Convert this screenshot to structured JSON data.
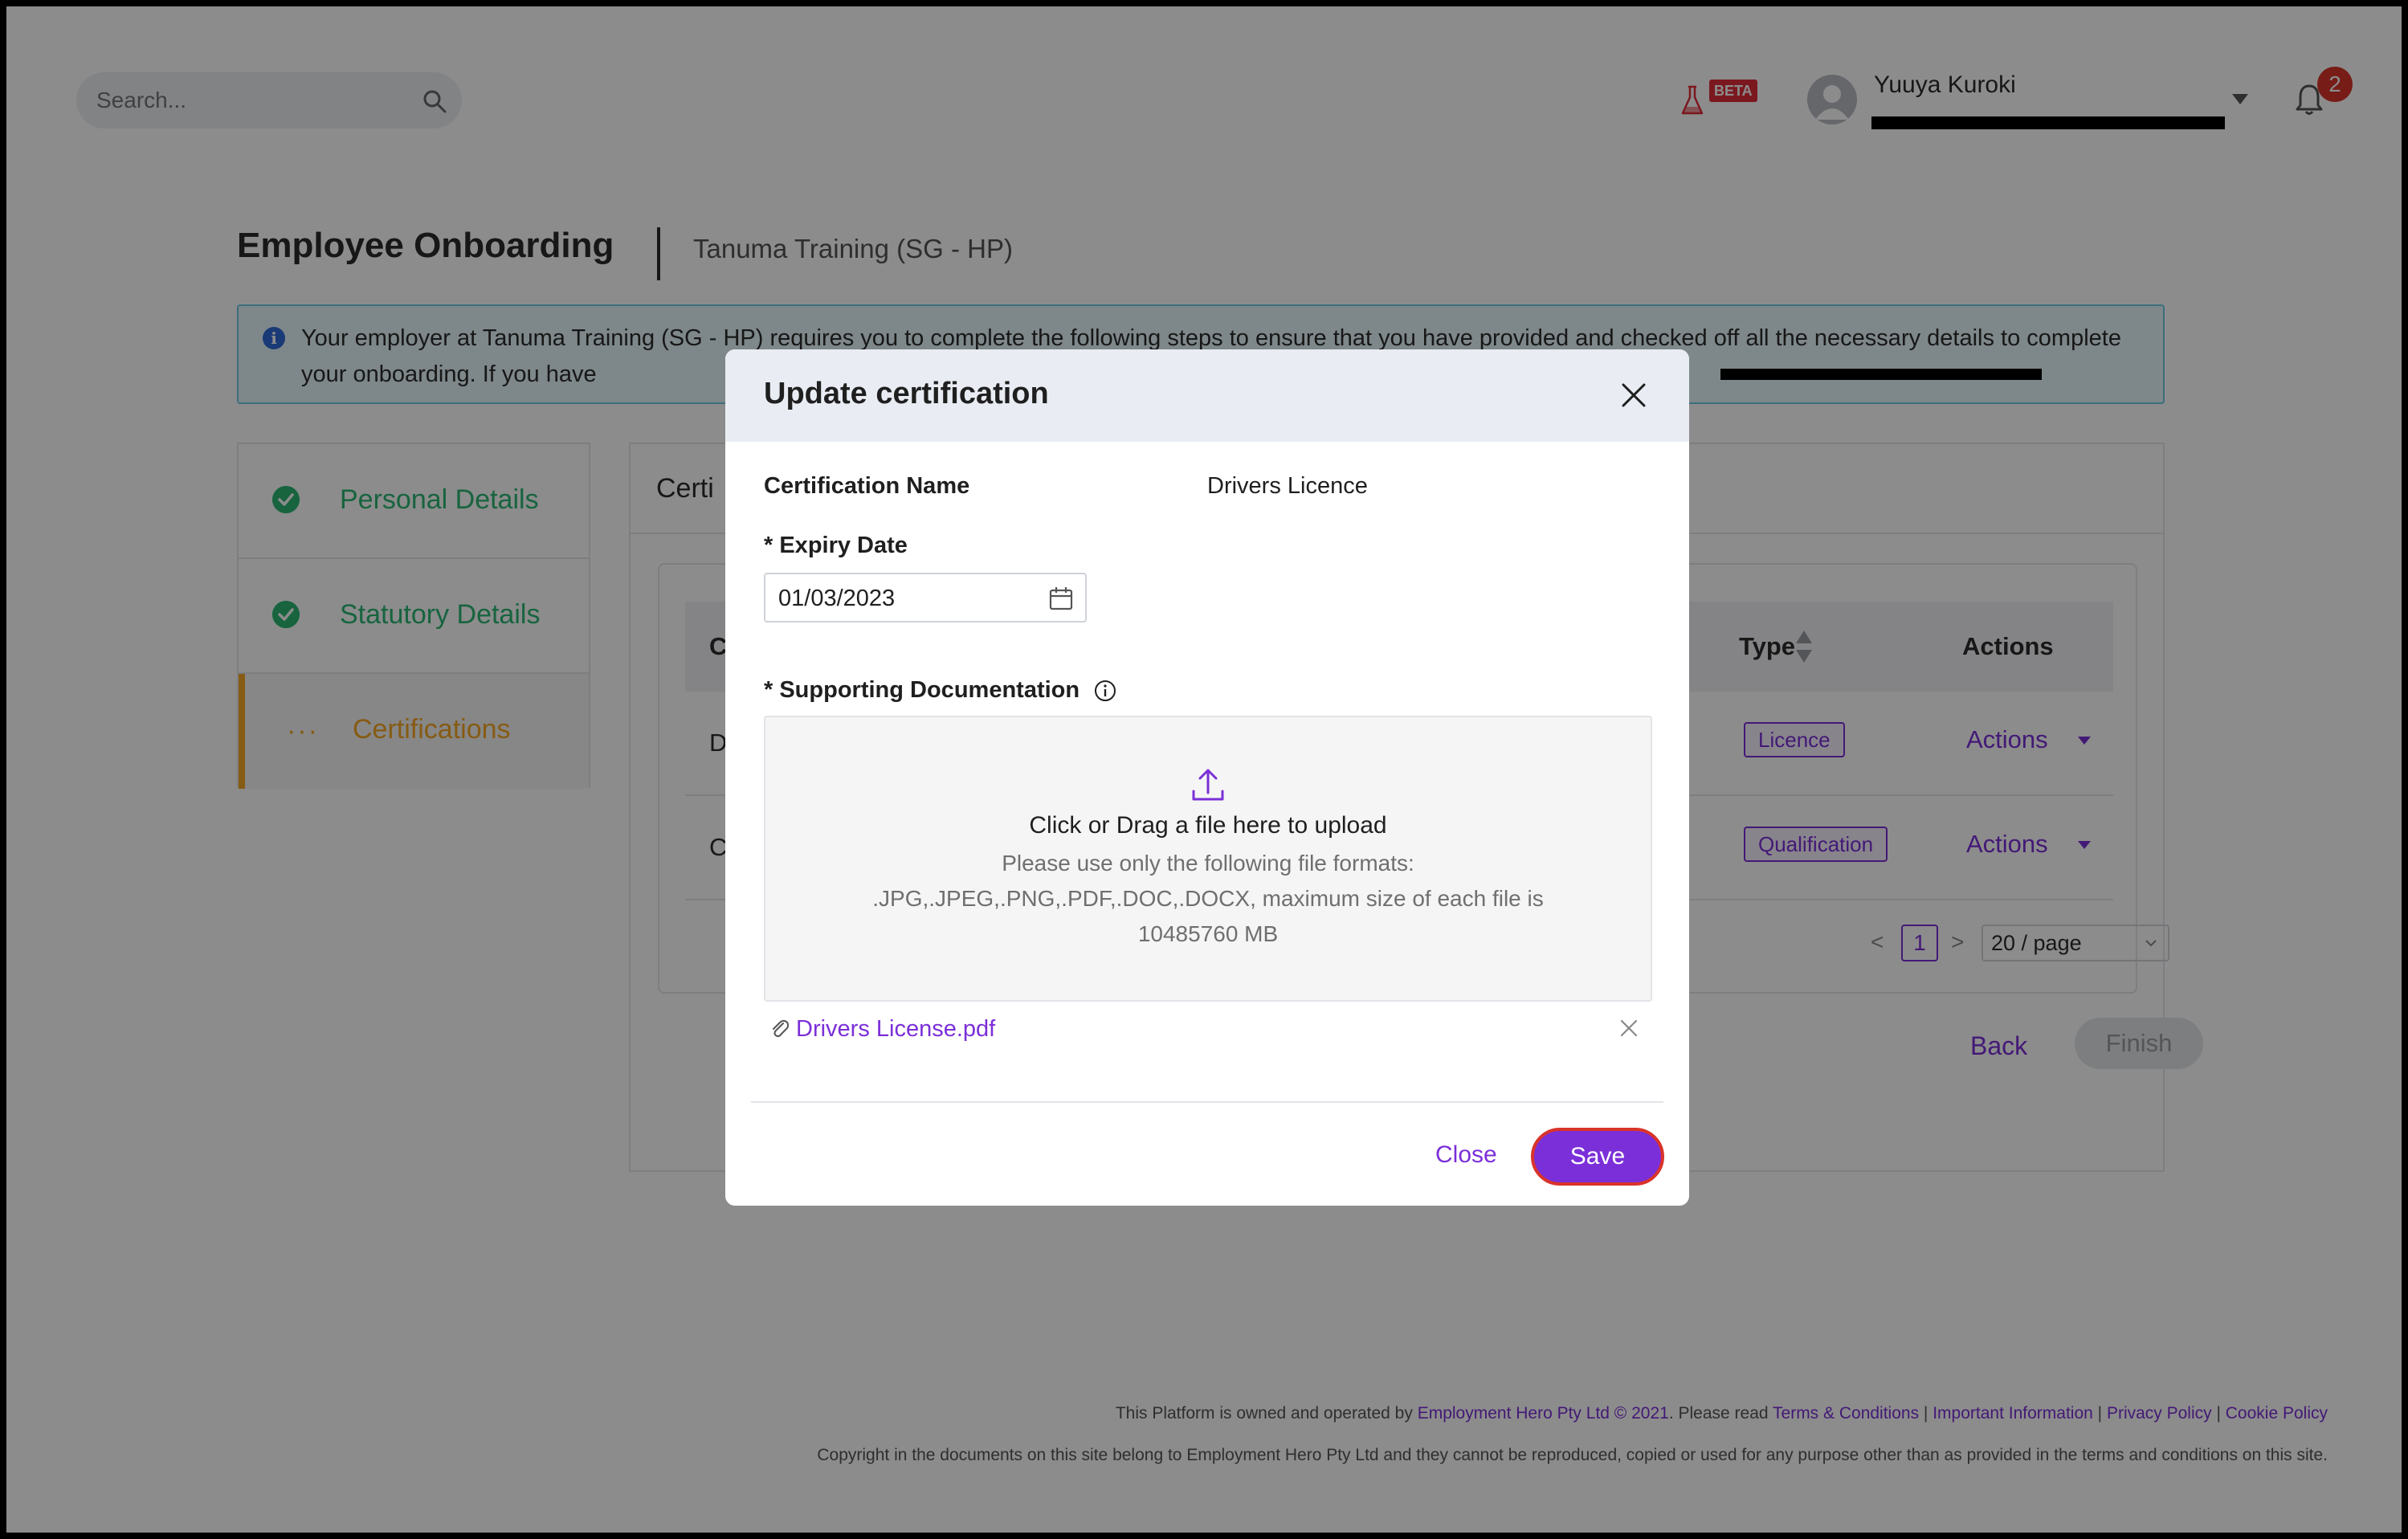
{
  "header": {
    "search_placeholder": "Search...",
    "beta_label": "BETA",
    "user_name": "Yuuya Kuroki",
    "notification_count": "2"
  },
  "page": {
    "title": "Employee Onboarding",
    "org_name": "Tanuma Training (SG - HP)",
    "info_text": "Your employer at Tanuma Training (SG - HP) requires you to complete the following steps to ensure that you have provided and checked off all the necessary details to complete your onboarding. If you have"
  },
  "steps": [
    {
      "label": "Personal Details",
      "status": "complete"
    },
    {
      "label": "Statutory Details",
      "status": "complete"
    },
    {
      "label": "Certifications",
      "status": "in-progress"
    }
  ],
  "certifications_panel": {
    "title": "Certi",
    "columns": {
      "first": "C",
      "type": "Type",
      "actions": "Actions"
    },
    "rows": [
      {
        "first": "D",
        "type": "Licence",
        "actions": "Actions"
      },
      {
        "first": "C",
        "type": "Qualification",
        "actions": "Actions"
      }
    ],
    "pagination": {
      "prev": "<",
      "current": "1",
      "next": ">",
      "page_size": "20 / page"
    },
    "back_label": "Back",
    "finish_label": "Finish"
  },
  "footer": {
    "line1_prefix": "This Platform is owned and operated by ",
    "company_link": "Employment Hero Pty Ltd © 2021",
    "line1_mid": ". Please read ",
    "terms_link": "Terms & Conditions",
    "sep": " | ",
    "info_link": "Important Information",
    "privacy_link": "Privacy Policy",
    "cookie_link": "Cookie Policy",
    "line2": "Copyright in the documents on this site belong to Employment Hero Pty Ltd and they cannot be reproduced, copied or used for any purpose other than as provided in the terms and conditions on this site."
  },
  "modal": {
    "title": "Update certification",
    "cert_name_label": "Certification Name",
    "cert_name_value": "Drivers Licence",
    "expiry_label": "* Expiry Date",
    "expiry_value": "01/03/2023",
    "docs_label": "* Supporting Documentation",
    "dropzone_main": "Click or Drag a file here to upload",
    "dropzone_sub": "Please use only the following file formats: .JPG,.JPEG,.PNG,.PDF,.DOC,.DOCX, maximum size of each file is 10485760 MB",
    "file_name": "Drivers License.pdf",
    "close_label": "Close",
    "save_label": "Save"
  },
  "colors": {
    "accent": "#7b2fd8",
    "success": "#2bb673",
    "in_progress": "#f5a623",
    "danger": "#d9332b"
  }
}
